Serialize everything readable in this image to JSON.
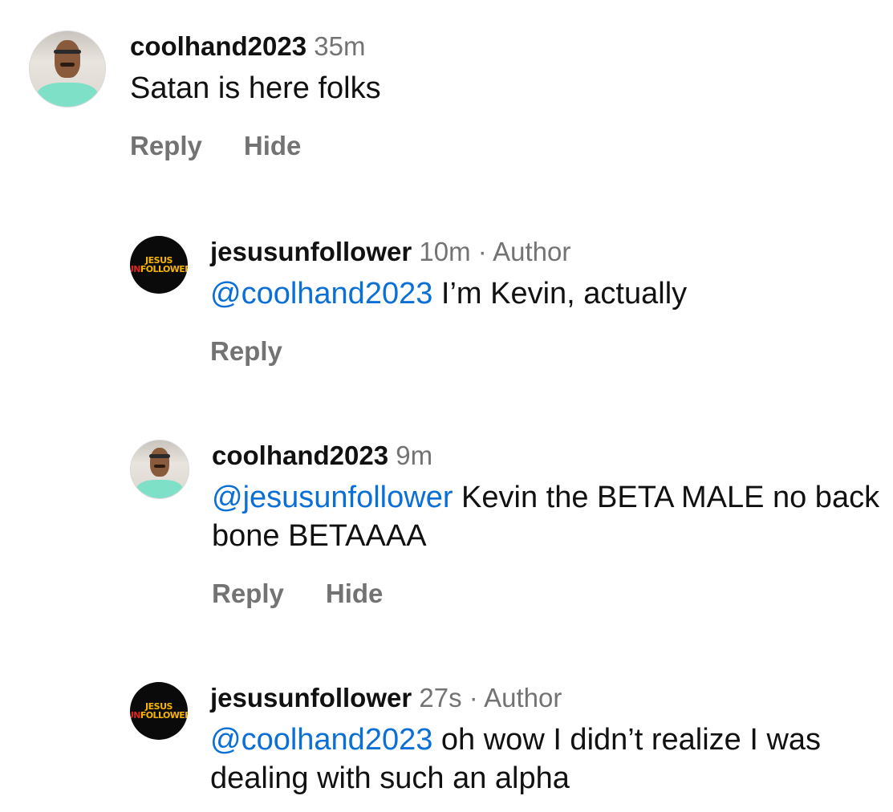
{
  "comments": [
    {
      "username": "coolhand2023",
      "time": "35m",
      "author_tag": "",
      "mention": "",
      "text": "Satan is here folks",
      "actions": [
        "Reply",
        "Hide"
      ],
      "avatar": "person-photo-avatar"
    },
    {
      "username": "jesusunfollower",
      "time": "10m",
      "author_tag": "· Author",
      "mention": "@coolhand2023",
      "text": " I’m Kevin, actually",
      "actions": [
        "Reply"
      ],
      "avatar": "brand-logo-avatar",
      "avatar_text_top": "JESUS",
      "avatar_text_un": "UN",
      "avatar_text_follower": "FOLLOWER"
    },
    {
      "username": "coolhand2023",
      "time": "9m",
      "author_tag": "",
      "mention": "@jesusunfollower",
      "text": " Kevin the BETA MALE no back bone BETAAAA",
      "actions": [
        "Reply",
        "Hide"
      ],
      "avatar": "person-photo-avatar"
    },
    {
      "username": "jesusunfollower",
      "time": "27s",
      "author_tag": "· Author",
      "mention": "@coolhand2023",
      "text": " oh wow I didn’t realize I was dealing with such an alpha",
      "actions": [],
      "avatar": "brand-logo-avatar",
      "avatar_text_top": "JESUS",
      "avatar_text_un": "UN",
      "avatar_text_follower": "FOLLOWER"
    }
  ],
  "colors": {
    "mention": "#0a6fd6",
    "meta": "#737373",
    "text": "#111111",
    "brand_yellow": "#f5b400",
    "brand_red": "#e2261c"
  }
}
